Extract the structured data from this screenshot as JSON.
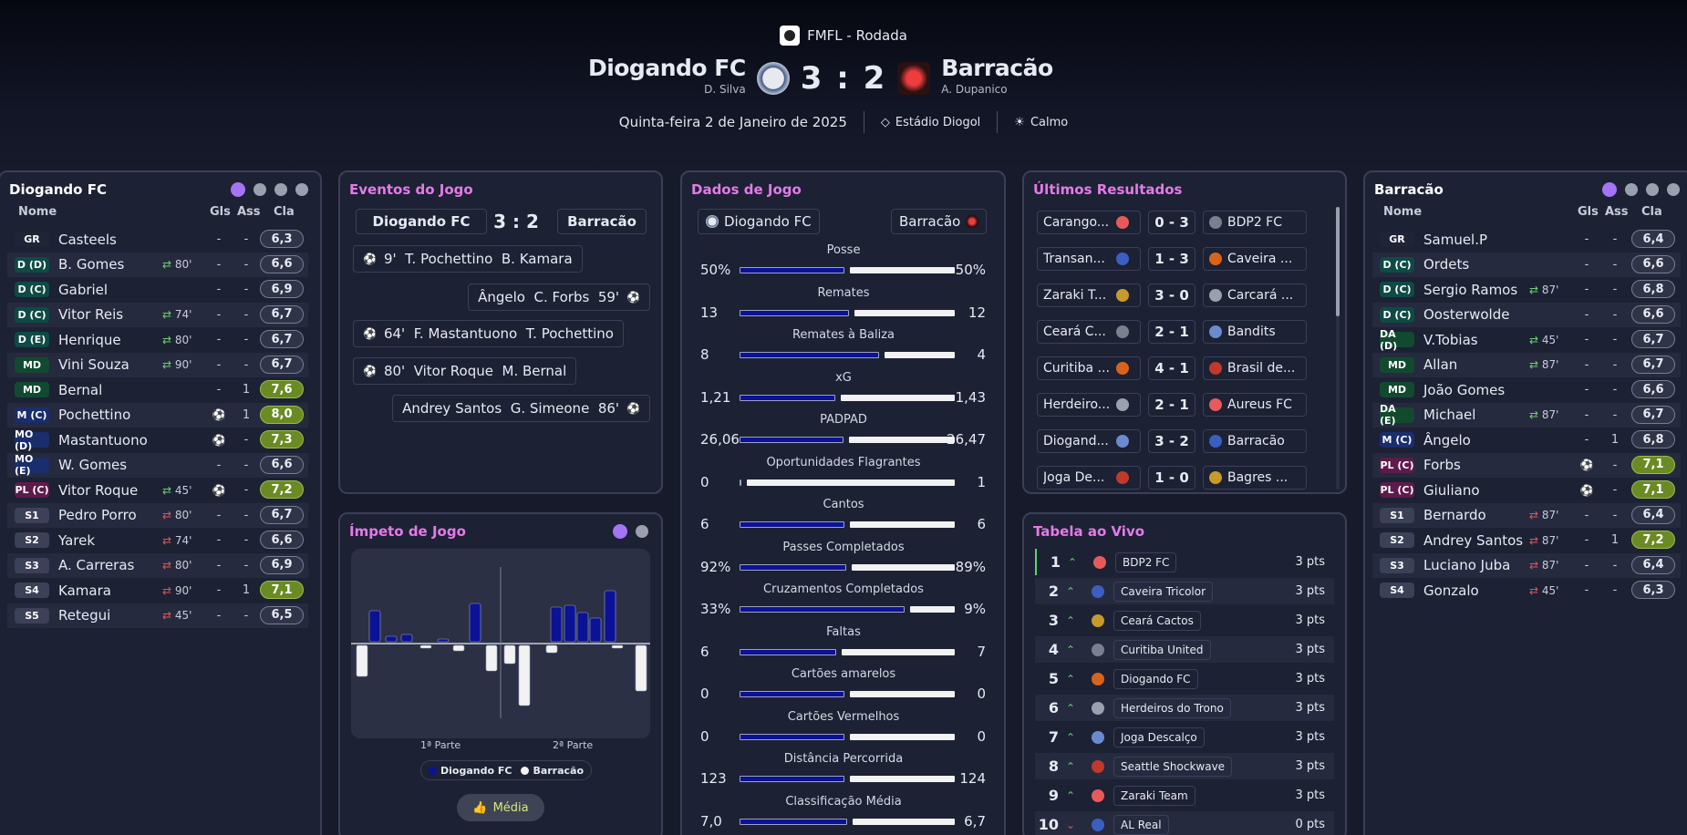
{
  "header": {
    "competition": "FMFL - Rodada",
    "home": {
      "name": "Diogando FC",
      "manager": "D. Silva",
      "crest": "diogando-crest"
    },
    "away": {
      "name": "Barracão",
      "manager": "A. Dupanico",
      "crest": "barracao-crest"
    },
    "score": "3 : 2",
    "date": "Quinta-feira 2 de Janeiro de 2025",
    "stadium": "Estádio Diogol",
    "weather": "Calmo"
  },
  "home_lineup": {
    "title": "Diogando FC",
    "cols": {
      "name": "Nome",
      "gls": "Gls",
      "ass": "Ass",
      "cla": "Cla"
    },
    "players": [
      {
        "pos": "GR",
        "name": "Casteels",
        "sub": "",
        "gls": "-",
        "ass": "-",
        "rating": "6,3"
      },
      {
        "pos": "D (D)",
        "name": "B. Gomes",
        "sub": "80'",
        "gls": "-",
        "ass": "-",
        "rating": "6,6"
      },
      {
        "pos": "D (C)",
        "name": "Gabriel",
        "sub": "",
        "gls": "-",
        "ass": "-",
        "rating": "6,9"
      },
      {
        "pos": "D (C)",
        "name": "Vitor Reis",
        "sub": "74'",
        "gls": "-",
        "ass": "-",
        "rating": "6,7"
      },
      {
        "pos": "D (E)",
        "name": "Henrique",
        "sub": "80'",
        "gls": "-",
        "ass": "-",
        "rating": "6,7"
      },
      {
        "pos": "MD",
        "name": "Vini Souza",
        "sub": "90'",
        "gls": "-",
        "ass": "-",
        "rating": "6,7"
      },
      {
        "pos": "MD",
        "name": "Bernal",
        "sub": "",
        "gls": "-",
        "ass": "1",
        "rating": "7,6"
      },
      {
        "pos": "M (C)",
        "name": "Pochettino",
        "sub": "",
        "gls": "goal",
        "ass": "1",
        "rating": "8,0"
      },
      {
        "pos": "MO (D)",
        "name": "Mastantuono",
        "sub": "",
        "gls": "goal",
        "ass": "-",
        "rating": "7,3"
      },
      {
        "pos": "MO (E)",
        "name": "W. Gomes",
        "sub": "",
        "gls": "-",
        "ass": "-",
        "rating": "6,6"
      },
      {
        "pos": "PL (C)",
        "name": "Vitor Roque",
        "sub": "45'",
        "gls": "goal",
        "ass": "-",
        "rating": "7,2"
      },
      {
        "pos": "S1",
        "name": "Pedro Porro",
        "sub": "80'",
        "gls": "-",
        "ass": "-",
        "rating": "6,7"
      },
      {
        "pos": "S2",
        "name": "Yarek",
        "sub": "74'",
        "gls": "-",
        "ass": "-",
        "rating": "6,6"
      },
      {
        "pos": "S3",
        "name": "A. Carreras",
        "sub": "80'",
        "gls": "-",
        "ass": "-",
        "rating": "6,9"
      },
      {
        "pos": "S4",
        "name": "Kamara",
        "sub": "90'",
        "gls": "-",
        "ass": "1",
        "rating": "7,1"
      },
      {
        "pos": "S5",
        "name": "Retegui",
        "sub": "45'",
        "gls": "-",
        "ass": "-",
        "rating": "6,5"
      }
    ]
  },
  "away_lineup": {
    "title": "Barracão",
    "cols": {
      "name": "Nome",
      "gls": "Gls",
      "ass": "Ass",
      "cla": "Cla"
    },
    "players": [
      {
        "pos": "GR",
        "name": "Samuel.P",
        "sub": "",
        "gls": "-",
        "ass": "-",
        "rating": "6,4"
      },
      {
        "pos": "D (C)",
        "name": "Ordets",
        "sub": "",
        "gls": "-",
        "ass": "-",
        "rating": "6,6"
      },
      {
        "pos": "D (C)",
        "name": "Sergio Ramos",
        "sub": "87'",
        "gls": "-",
        "ass": "-",
        "rating": "6,8"
      },
      {
        "pos": "D (C)",
        "name": "Oosterwolde",
        "sub": "",
        "gls": "-",
        "ass": "-",
        "rating": "6,6"
      },
      {
        "pos": "DA (D)",
        "name": "V.Tobias",
        "sub": "45'",
        "gls": "-",
        "ass": "-",
        "rating": "6,7"
      },
      {
        "pos": "MD",
        "name": "Allan",
        "sub": "87'",
        "gls": "-",
        "ass": "-",
        "rating": "6,7"
      },
      {
        "pos": "MD",
        "name": "João Gomes",
        "sub": "",
        "gls": "-",
        "ass": "-",
        "rating": "6,6"
      },
      {
        "pos": "DA (E)",
        "name": "Michael",
        "sub": "87'",
        "gls": "-",
        "ass": "-",
        "rating": "6,7"
      },
      {
        "pos": "M (C)",
        "name": "Ângelo",
        "sub": "",
        "gls": "-",
        "ass": "1",
        "rating": "6,8"
      },
      {
        "pos": "PL (C)",
        "name": "Forbs",
        "sub": "",
        "gls": "goal",
        "ass": "-",
        "rating": "7,1"
      },
      {
        "pos": "PL (C)",
        "name": "Giuliano",
        "sub": "",
        "gls": "goal",
        "ass": "-",
        "rating": "7,1"
      },
      {
        "pos": "S1",
        "name": "Bernardo",
        "sub": "87'",
        "gls": "-",
        "ass": "-",
        "rating": "6,4"
      },
      {
        "pos": "S2",
        "name": "Andrey Santos",
        "sub": "87'",
        "gls": "-",
        "ass": "1",
        "rating": "7,2"
      },
      {
        "pos": "S3",
        "name": "Luciano Juba",
        "sub": "87'",
        "gls": "-",
        "ass": "-",
        "rating": "6,4"
      },
      {
        "pos": "S4",
        "name": "Gonzalo",
        "sub": "45'",
        "gls": "-",
        "ass": "-",
        "rating": "6,3"
      }
    ]
  },
  "events": {
    "title": "Eventos do Jogo",
    "home": "Diogando FC",
    "away": "Barracão",
    "score": "3 : 2",
    "list": [
      {
        "side": "home",
        "text": "9'  T. Pochettino  B. Kamara"
      },
      {
        "side": "away",
        "text": "Ângelo  C. Forbs  59'"
      },
      {
        "side": "home",
        "text": "64'  F. Mastantuono  T. Pochettino"
      },
      {
        "side": "home",
        "text": "80'  Vitor Roque  M. Bernal"
      },
      {
        "side": "away",
        "text": "Andrey Santos  G. Simeone  86'"
      }
    ]
  },
  "momentum": {
    "title": "Ímpeto de Jogo",
    "half1": "1ª Parte",
    "half2": "2ª Parte",
    "legend_home": "Diogando FC",
    "legend_away": "Barracão",
    "button": "Média"
  },
  "stats": {
    "title": "Dados de Jogo",
    "home": "Diogando FC",
    "away": "Barracão",
    "rows": [
      {
        "label": "Posse",
        "home": "50%",
        "away": "50%",
        "hv": 50,
        "av": 50
      },
      {
        "label": "Remates",
        "home": "13",
        "away": "12",
        "hv": 13,
        "av": 12
      },
      {
        "label": "Remates à Baliza",
        "home": "8",
        "away": "4",
        "hv": 8,
        "av": 4
      },
      {
        "label": "xG",
        "home": "1,21",
        "away": "1,43",
        "hv": 1.21,
        "av": 1.43
      },
      {
        "label": "PADPAD",
        "home": "26,06",
        "away": "26,47",
        "hv": 26.06,
        "av": 26.47
      },
      {
        "label": "Oportunidades Flagrantes",
        "home": "0",
        "away": "1",
        "hv": 0,
        "av": 1
      },
      {
        "label": "Cantos",
        "home": "6",
        "away": "6",
        "hv": 6,
        "av": 6
      },
      {
        "label": "Passes Completados",
        "home": "92%",
        "away": "89%",
        "hv": 92,
        "av": 89
      },
      {
        "label": "Cruzamentos Completados",
        "home": "33%",
        "away": "9%",
        "hv": 33,
        "av": 9
      },
      {
        "label": "Faltas",
        "home": "6",
        "away": "7",
        "hv": 6,
        "av": 7
      },
      {
        "label": "Cartões amarelos",
        "home": "0",
        "away": "0",
        "hv": 0,
        "av": 0
      },
      {
        "label": "Cartões Vermelhos",
        "home": "0",
        "away": "0",
        "hv": 0,
        "av": 0
      },
      {
        "label": "Distância Percorrida",
        "home": "123",
        "away": "124",
        "hv": 123,
        "av": 124
      },
      {
        "label": "Classificação Média",
        "home": "7,0",
        "away": "6,7",
        "hv": 7.0,
        "av": 6.7
      }
    ]
  },
  "results": {
    "title": "Últimos Resultados",
    "list": [
      {
        "home": "Carango...",
        "score": "0 - 3",
        "away": "BDP2 FC"
      },
      {
        "home": "Transan...",
        "score": "1 - 3",
        "away": "Caveira ..."
      },
      {
        "home": "Zaraki T...",
        "score": "3 - 0",
        "away": "Carcará ..."
      },
      {
        "home": "Ceará C...",
        "score": "2 - 1",
        "away": "Bandits"
      },
      {
        "home": "Curitiba ...",
        "score": "4 - 1",
        "away": "Brasil de..."
      },
      {
        "home": "Herdeiro...",
        "score": "2 - 1",
        "away": "Aureus FC"
      },
      {
        "home": "Diogand...",
        "score": "3 - 2",
        "away": "Barracão"
      },
      {
        "home": "Joga De...",
        "score": "1 - 0",
        "away": "Bagres ..."
      }
    ]
  },
  "table": {
    "title": "Tabela ao Vivo",
    "rows": [
      {
        "pos": "1",
        "dir": "up",
        "team": "BDP2 FC",
        "pts": "3 pts"
      },
      {
        "pos": "2",
        "dir": "up",
        "team": "Caveira Tricolor",
        "pts": "3 pts"
      },
      {
        "pos": "3",
        "dir": "up",
        "team": "Ceará Cactos",
        "pts": "3 pts"
      },
      {
        "pos": "4",
        "dir": "up",
        "team": "Curitiba United",
        "pts": "3 pts"
      },
      {
        "pos": "5",
        "dir": "up",
        "team": "Diogando FC",
        "pts": "3 pts"
      },
      {
        "pos": "6",
        "dir": "up",
        "team": "Herdeiros do Trono",
        "pts": "3 pts"
      },
      {
        "pos": "7",
        "dir": "up",
        "team": "Joga Descalço",
        "pts": "3 pts"
      },
      {
        "pos": "8",
        "dir": "up",
        "team": "Seattle Shockwave",
        "pts": "3 pts"
      },
      {
        "pos": "9",
        "dir": "up",
        "team": "Zaraki Team",
        "pts": "3 pts"
      },
      {
        "pos": "10",
        "dir": "down",
        "team": "AL Real",
        "pts": "0 pts"
      }
    ]
  },
  "colors": {
    "accent": "#e57ae8",
    "home_bar": "#0c1296",
    "away_bar": "#f2f2f2",
    "good_rating": "#6a8a24"
  }
}
